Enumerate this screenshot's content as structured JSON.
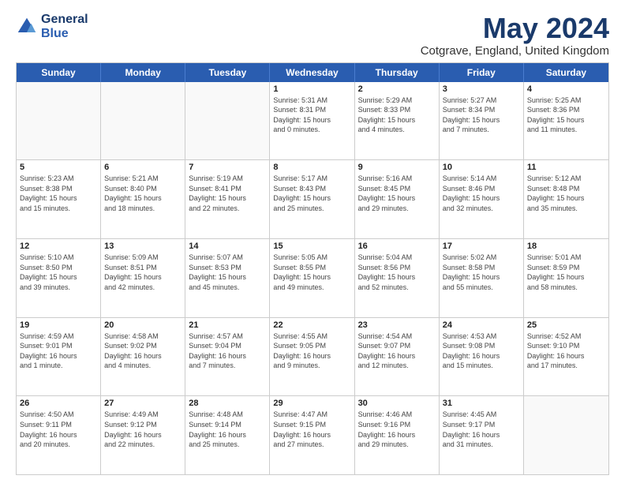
{
  "logo": {
    "line1": "General",
    "line2": "Blue"
  },
  "title": "May 2024",
  "subtitle": "Cotgrave, England, United Kingdom",
  "days_of_week": [
    "Sunday",
    "Monday",
    "Tuesday",
    "Wednesday",
    "Thursday",
    "Friday",
    "Saturday"
  ],
  "weeks": [
    [
      {
        "day": "",
        "info": ""
      },
      {
        "day": "",
        "info": ""
      },
      {
        "day": "",
        "info": ""
      },
      {
        "day": "1",
        "info": "Sunrise: 5:31 AM\nSunset: 8:31 PM\nDaylight: 15 hours\nand 0 minutes."
      },
      {
        "day": "2",
        "info": "Sunrise: 5:29 AM\nSunset: 8:33 PM\nDaylight: 15 hours\nand 4 minutes."
      },
      {
        "day": "3",
        "info": "Sunrise: 5:27 AM\nSunset: 8:34 PM\nDaylight: 15 hours\nand 7 minutes."
      },
      {
        "day": "4",
        "info": "Sunrise: 5:25 AM\nSunset: 8:36 PM\nDaylight: 15 hours\nand 11 minutes."
      }
    ],
    [
      {
        "day": "5",
        "info": "Sunrise: 5:23 AM\nSunset: 8:38 PM\nDaylight: 15 hours\nand 15 minutes."
      },
      {
        "day": "6",
        "info": "Sunrise: 5:21 AM\nSunset: 8:40 PM\nDaylight: 15 hours\nand 18 minutes."
      },
      {
        "day": "7",
        "info": "Sunrise: 5:19 AM\nSunset: 8:41 PM\nDaylight: 15 hours\nand 22 minutes."
      },
      {
        "day": "8",
        "info": "Sunrise: 5:17 AM\nSunset: 8:43 PM\nDaylight: 15 hours\nand 25 minutes."
      },
      {
        "day": "9",
        "info": "Sunrise: 5:16 AM\nSunset: 8:45 PM\nDaylight: 15 hours\nand 29 minutes."
      },
      {
        "day": "10",
        "info": "Sunrise: 5:14 AM\nSunset: 8:46 PM\nDaylight: 15 hours\nand 32 minutes."
      },
      {
        "day": "11",
        "info": "Sunrise: 5:12 AM\nSunset: 8:48 PM\nDaylight: 15 hours\nand 35 minutes."
      }
    ],
    [
      {
        "day": "12",
        "info": "Sunrise: 5:10 AM\nSunset: 8:50 PM\nDaylight: 15 hours\nand 39 minutes."
      },
      {
        "day": "13",
        "info": "Sunrise: 5:09 AM\nSunset: 8:51 PM\nDaylight: 15 hours\nand 42 minutes."
      },
      {
        "day": "14",
        "info": "Sunrise: 5:07 AM\nSunset: 8:53 PM\nDaylight: 15 hours\nand 45 minutes."
      },
      {
        "day": "15",
        "info": "Sunrise: 5:05 AM\nSunset: 8:55 PM\nDaylight: 15 hours\nand 49 minutes."
      },
      {
        "day": "16",
        "info": "Sunrise: 5:04 AM\nSunset: 8:56 PM\nDaylight: 15 hours\nand 52 minutes."
      },
      {
        "day": "17",
        "info": "Sunrise: 5:02 AM\nSunset: 8:58 PM\nDaylight: 15 hours\nand 55 minutes."
      },
      {
        "day": "18",
        "info": "Sunrise: 5:01 AM\nSunset: 8:59 PM\nDaylight: 15 hours\nand 58 minutes."
      }
    ],
    [
      {
        "day": "19",
        "info": "Sunrise: 4:59 AM\nSunset: 9:01 PM\nDaylight: 16 hours\nand 1 minute."
      },
      {
        "day": "20",
        "info": "Sunrise: 4:58 AM\nSunset: 9:02 PM\nDaylight: 16 hours\nand 4 minutes."
      },
      {
        "day": "21",
        "info": "Sunrise: 4:57 AM\nSunset: 9:04 PM\nDaylight: 16 hours\nand 7 minutes."
      },
      {
        "day": "22",
        "info": "Sunrise: 4:55 AM\nSunset: 9:05 PM\nDaylight: 16 hours\nand 9 minutes."
      },
      {
        "day": "23",
        "info": "Sunrise: 4:54 AM\nSunset: 9:07 PM\nDaylight: 16 hours\nand 12 minutes."
      },
      {
        "day": "24",
        "info": "Sunrise: 4:53 AM\nSunset: 9:08 PM\nDaylight: 16 hours\nand 15 minutes."
      },
      {
        "day": "25",
        "info": "Sunrise: 4:52 AM\nSunset: 9:10 PM\nDaylight: 16 hours\nand 17 minutes."
      }
    ],
    [
      {
        "day": "26",
        "info": "Sunrise: 4:50 AM\nSunset: 9:11 PM\nDaylight: 16 hours\nand 20 minutes."
      },
      {
        "day": "27",
        "info": "Sunrise: 4:49 AM\nSunset: 9:12 PM\nDaylight: 16 hours\nand 22 minutes."
      },
      {
        "day": "28",
        "info": "Sunrise: 4:48 AM\nSunset: 9:14 PM\nDaylight: 16 hours\nand 25 minutes."
      },
      {
        "day": "29",
        "info": "Sunrise: 4:47 AM\nSunset: 9:15 PM\nDaylight: 16 hours\nand 27 minutes."
      },
      {
        "day": "30",
        "info": "Sunrise: 4:46 AM\nSunset: 9:16 PM\nDaylight: 16 hours\nand 29 minutes."
      },
      {
        "day": "31",
        "info": "Sunrise: 4:45 AM\nSunset: 9:17 PM\nDaylight: 16 hours\nand 31 minutes."
      },
      {
        "day": "",
        "info": ""
      }
    ]
  ]
}
